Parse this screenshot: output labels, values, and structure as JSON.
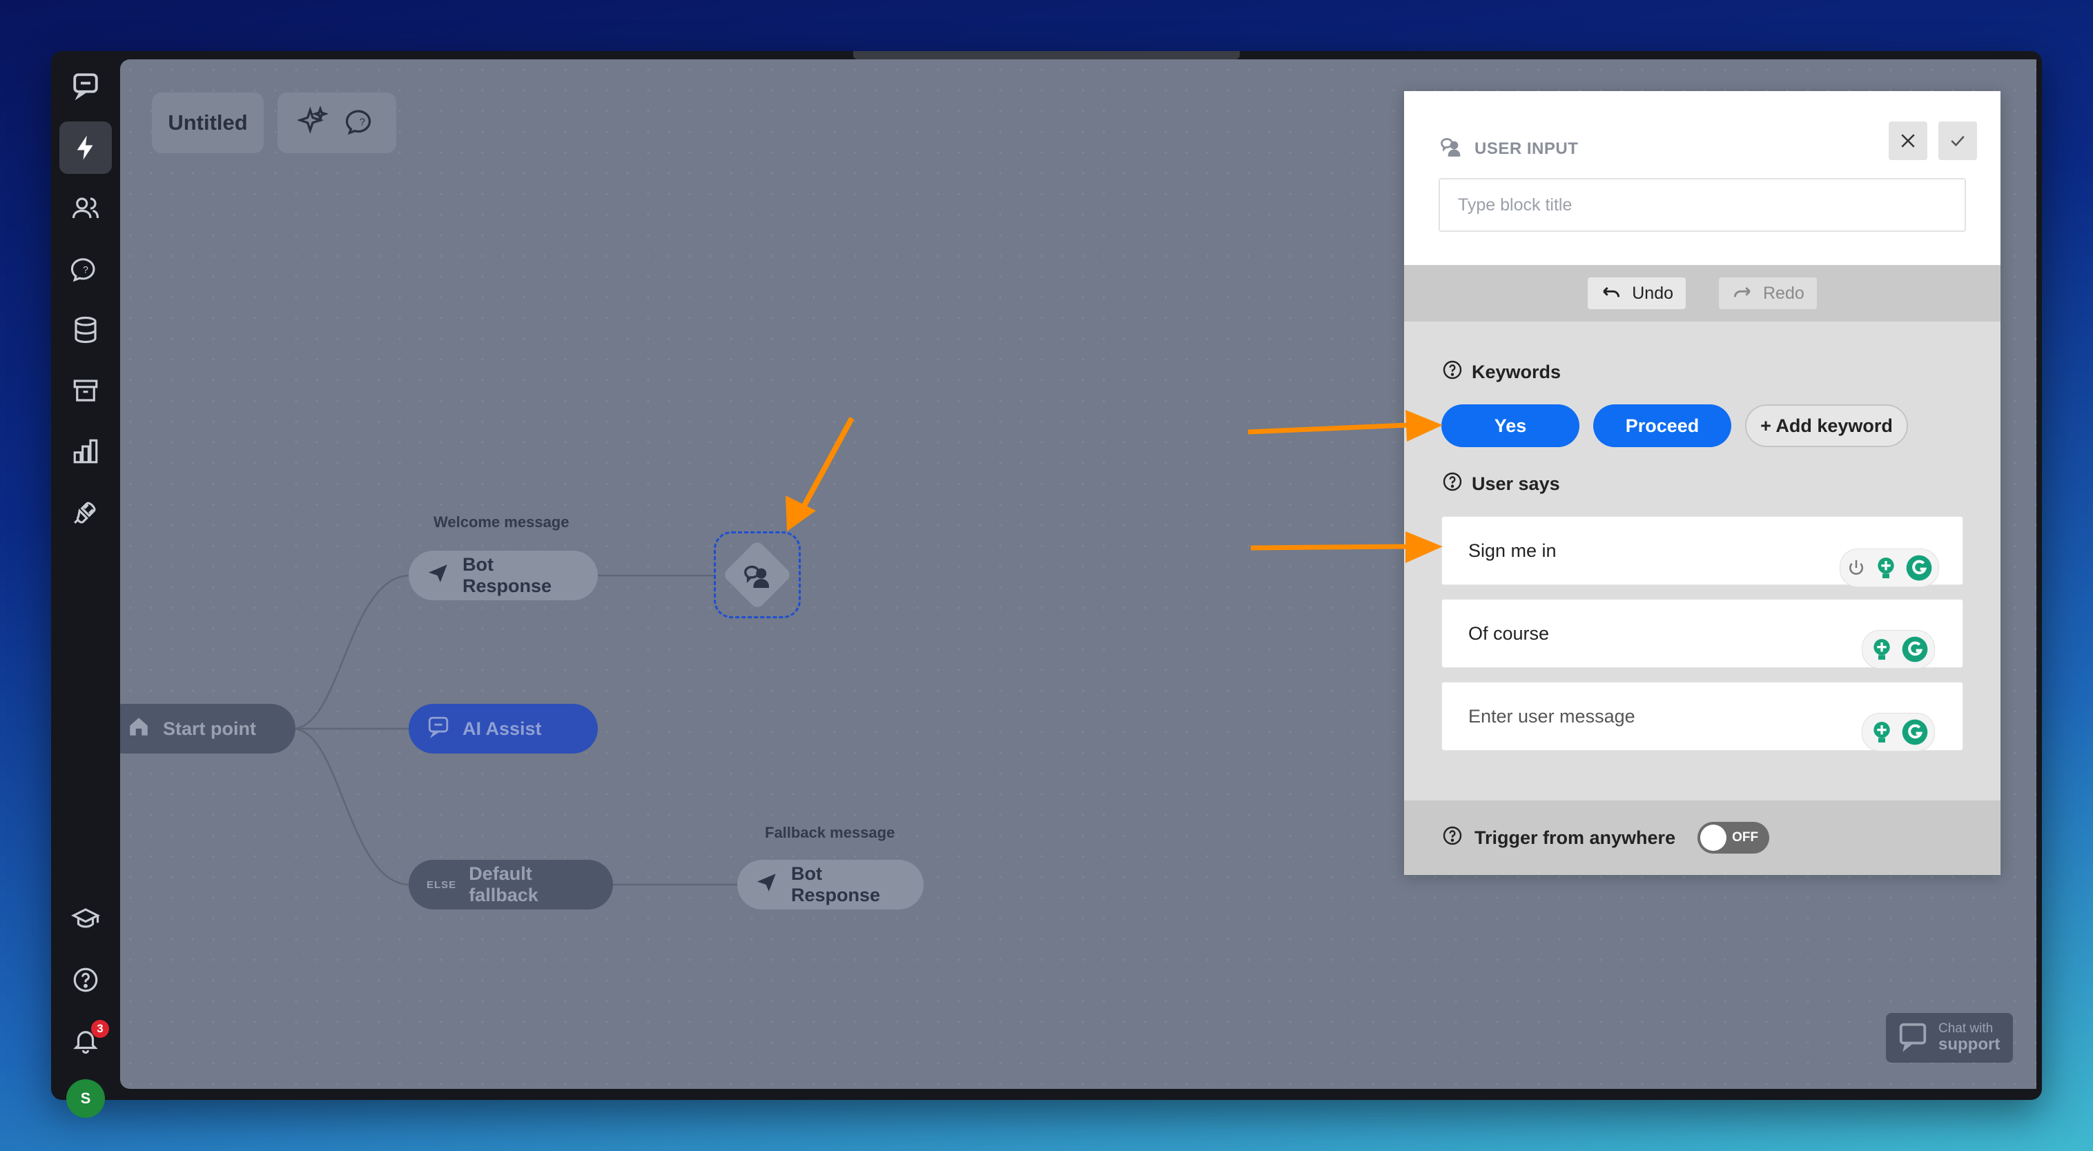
{
  "sidebar": {
    "items": [
      {
        "icon": "chat-logo-icon"
      },
      {
        "icon": "lightning-icon",
        "active": true
      },
      {
        "icon": "users-icon"
      },
      {
        "icon": "chat-question-icon"
      },
      {
        "icon": "database-icon"
      },
      {
        "icon": "archive-icon"
      },
      {
        "icon": "bar-chart-icon"
      },
      {
        "icon": "plug-icon"
      }
    ],
    "bottom": [
      {
        "icon": "graduation-cap-icon"
      },
      {
        "icon": "help-circle-icon"
      },
      {
        "icon": "bell-icon",
        "badge": "3"
      }
    ],
    "avatar_initial": "S"
  },
  "canvas": {
    "title": "Untitled",
    "nodes": {
      "welcome_label": "Welcome message",
      "bot_response_1": "Bot Response",
      "start_point": "Start point",
      "ai_assist": "AI Assist",
      "else_tag": "ELSE",
      "default_fallback": "Default fallback",
      "fallback_label": "Fallback message",
      "bot_response_2": "Bot Response"
    },
    "support": {
      "line1": "Chat with",
      "line2": "support"
    }
  },
  "panel": {
    "type_label": "USER INPUT",
    "title_placeholder": "Type block title",
    "undo_label": "Undo",
    "redo_label": "Redo",
    "keywords_label": "Keywords",
    "keywords": [
      "Yes",
      "Proceed"
    ],
    "add_keyword_label": "+ Add keyword",
    "user_says_label": "User says",
    "user_says": [
      "Sign me in",
      "Of course"
    ],
    "user_message_placeholder": "Enter user message",
    "trigger_label": "Trigger from anywhere",
    "trigger_state": "OFF"
  },
  "colors": {
    "accent_blue": "#0e6df2",
    "annotation_arrow": "#ff8c00",
    "canvas_bg": "#727a8b",
    "selection_dash": "#1f4fd1"
  }
}
